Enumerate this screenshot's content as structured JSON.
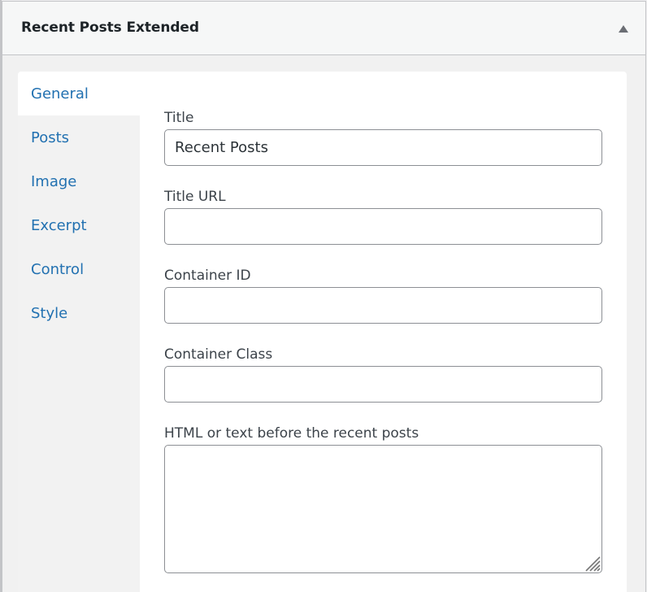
{
  "widget": {
    "title": "Recent Posts Extended",
    "toggle_icon": "triangle-up-icon"
  },
  "tabs": [
    {
      "label": "General",
      "active": true
    },
    {
      "label": "Posts",
      "active": false
    },
    {
      "label": "Image",
      "active": false
    },
    {
      "label": "Excerpt",
      "active": false
    },
    {
      "label": "Control",
      "active": false
    },
    {
      "label": "Style",
      "active": false
    }
  ],
  "form": {
    "title": {
      "label": "Title",
      "value": "Recent Posts"
    },
    "title_url": {
      "label": "Title URL",
      "value": ""
    },
    "container_id": {
      "label": "Container ID",
      "value": ""
    },
    "container_class": {
      "label": "Container Class",
      "value": ""
    },
    "before_html": {
      "label": "HTML or text before the recent posts",
      "value": ""
    }
  },
  "colors": {
    "accent": "#2271b1",
    "header_bg": "#f6f7f7",
    "border": "#c3c4c7"
  }
}
